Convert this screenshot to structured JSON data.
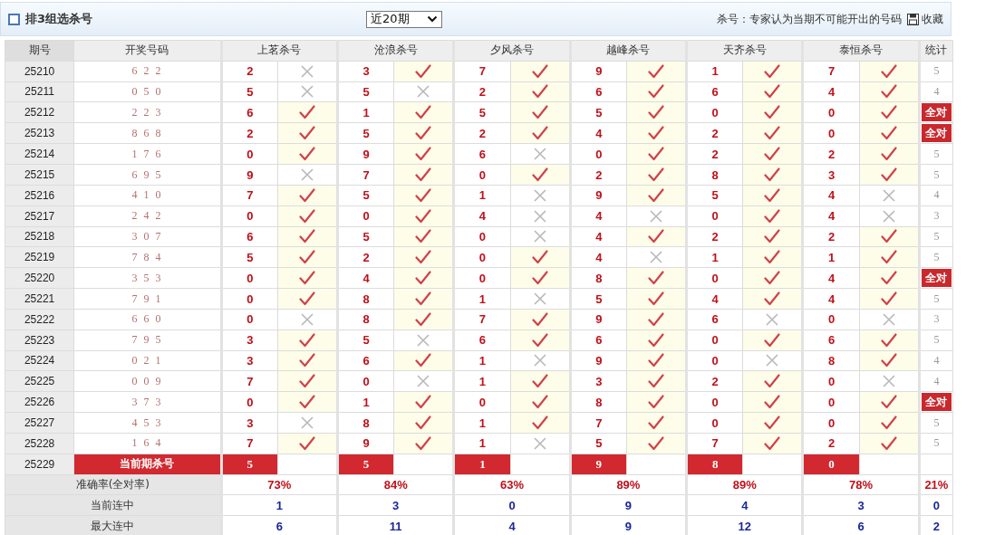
{
  "title": "排3组选杀号",
  "period_select": {
    "value": "近20期"
  },
  "note": "杀号：专家认为当期不可能开出的号码",
  "save_link": "收藏",
  "columns": {
    "period": "期号",
    "draw": "开奖号码",
    "experts": [
      "上茗杀号",
      "沧浪杀号",
      "夕风杀号",
      "越峰杀号",
      "天齐杀号",
      "泰恒杀号"
    ],
    "stat": "统计"
  },
  "rows": [
    {
      "period": "25210",
      "draw": "6 2 2",
      "picks": [
        {
          "number": "2",
          "hit": false
        },
        {
          "number": "3",
          "hit": true
        },
        {
          "number": "7",
          "hit": true
        },
        {
          "number": "9",
          "hit": true
        },
        {
          "number": "1",
          "hit": true
        },
        {
          "number": "7",
          "hit": true
        }
      ],
      "stat": "5",
      "all_correct": false
    },
    {
      "period": "25211",
      "draw": "0 5 0",
      "picks": [
        {
          "number": "5",
          "hit": false
        },
        {
          "number": "5",
          "hit": false
        },
        {
          "number": "2",
          "hit": true
        },
        {
          "number": "6",
          "hit": true
        },
        {
          "number": "6",
          "hit": true
        },
        {
          "number": "4",
          "hit": true
        }
      ],
      "stat": "4",
      "all_correct": false
    },
    {
      "period": "25212",
      "draw": "2 2 3",
      "picks": [
        {
          "number": "6",
          "hit": true
        },
        {
          "number": "1",
          "hit": true
        },
        {
          "number": "5",
          "hit": true
        },
        {
          "number": "5",
          "hit": true
        },
        {
          "number": "0",
          "hit": true
        },
        {
          "number": "0",
          "hit": true
        }
      ],
      "stat": "全对",
      "all_correct": true
    },
    {
      "period": "25213",
      "draw": "8 6 8",
      "picks": [
        {
          "number": "2",
          "hit": true
        },
        {
          "number": "5",
          "hit": true
        },
        {
          "number": "2",
          "hit": true
        },
        {
          "number": "4",
          "hit": true
        },
        {
          "number": "2",
          "hit": true
        },
        {
          "number": "0",
          "hit": true
        }
      ],
      "stat": "全对",
      "all_correct": true
    },
    {
      "period": "25214",
      "draw": "1 7 6",
      "picks": [
        {
          "number": "0",
          "hit": true
        },
        {
          "number": "9",
          "hit": true
        },
        {
          "number": "6",
          "hit": false
        },
        {
          "number": "0",
          "hit": true
        },
        {
          "number": "2",
          "hit": true
        },
        {
          "number": "2",
          "hit": true
        }
      ],
      "stat": "5",
      "all_correct": false
    },
    {
      "period": "25215",
      "draw": "6 9 5",
      "picks": [
        {
          "number": "9",
          "hit": false
        },
        {
          "number": "7",
          "hit": true
        },
        {
          "number": "0",
          "hit": true
        },
        {
          "number": "2",
          "hit": true
        },
        {
          "number": "8",
          "hit": true
        },
        {
          "number": "3",
          "hit": true
        }
      ],
      "stat": "5",
      "all_correct": false
    },
    {
      "period": "25216",
      "draw": "4 1 0",
      "picks": [
        {
          "number": "7",
          "hit": true
        },
        {
          "number": "5",
          "hit": true
        },
        {
          "number": "1",
          "hit": false
        },
        {
          "number": "9",
          "hit": true
        },
        {
          "number": "5",
          "hit": true
        },
        {
          "number": "4",
          "hit": false
        }
      ],
      "stat": "4",
      "all_correct": false
    },
    {
      "period": "25217",
      "draw": "2 4 2",
      "picks": [
        {
          "number": "0",
          "hit": true
        },
        {
          "number": "0",
          "hit": true
        },
        {
          "number": "4",
          "hit": false
        },
        {
          "number": "4",
          "hit": false
        },
        {
          "number": "0",
          "hit": true
        },
        {
          "number": "4",
          "hit": false
        }
      ],
      "stat": "3",
      "all_correct": false
    },
    {
      "period": "25218",
      "draw": "3 0 7",
      "picks": [
        {
          "number": "6",
          "hit": true
        },
        {
          "number": "5",
          "hit": true
        },
        {
          "number": "0",
          "hit": false
        },
        {
          "number": "4",
          "hit": true
        },
        {
          "number": "2",
          "hit": true
        },
        {
          "number": "2",
          "hit": true
        }
      ],
      "stat": "5",
      "all_correct": false
    },
    {
      "period": "25219",
      "draw": "7 8 4",
      "picks": [
        {
          "number": "5",
          "hit": true
        },
        {
          "number": "2",
          "hit": true
        },
        {
          "number": "0",
          "hit": true
        },
        {
          "number": "4",
          "hit": false
        },
        {
          "number": "1",
          "hit": true
        },
        {
          "number": "1",
          "hit": true
        }
      ],
      "stat": "5",
      "all_correct": false
    },
    {
      "period": "25220",
      "draw": "3 5 3",
      "picks": [
        {
          "number": "0",
          "hit": true
        },
        {
          "number": "4",
          "hit": true
        },
        {
          "number": "0",
          "hit": true
        },
        {
          "number": "8",
          "hit": true
        },
        {
          "number": "0",
          "hit": true
        },
        {
          "number": "4",
          "hit": true
        }
      ],
      "stat": "全对",
      "all_correct": true
    },
    {
      "period": "25221",
      "draw": "7 9 1",
      "picks": [
        {
          "number": "0",
          "hit": true
        },
        {
          "number": "8",
          "hit": true
        },
        {
          "number": "1",
          "hit": false
        },
        {
          "number": "5",
          "hit": true
        },
        {
          "number": "4",
          "hit": true
        },
        {
          "number": "4",
          "hit": true
        }
      ],
      "stat": "5",
      "all_correct": false
    },
    {
      "period": "25222",
      "draw": "6 6 0",
      "picks": [
        {
          "number": "0",
          "hit": false
        },
        {
          "number": "8",
          "hit": true
        },
        {
          "number": "7",
          "hit": true
        },
        {
          "number": "9",
          "hit": true
        },
        {
          "number": "6",
          "hit": false
        },
        {
          "number": "0",
          "hit": false
        }
      ],
      "stat": "3",
      "all_correct": false
    },
    {
      "period": "25223",
      "draw": "7 9 5",
      "picks": [
        {
          "number": "3",
          "hit": true
        },
        {
          "number": "5",
          "hit": false
        },
        {
          "number": "6",
          "hit": true
        },
        {
          "number": "6",
          "hit": true
        },
        {
          "number": "0",
          "hit": true
        },
        {
          "number": "6",
          "hit": true
        }
      ],
      "stat": "5",
      "all_correct": false
    },
    {
      "period": "25224",
      "draw": "0 2 1",
      "picks": [
        {
          "number": "3",
          "hit": true
        },
        {
          "number": "6",
          "hit": true
        },
        {
          "number": "1",
          "hit": false
        },
        {
          "number": "9",
          "hit": true
        },
        {
          "number": "0",
          "hit": false
        },
        {
          "number": "8",
          "hit": true
        }
      ],
      "stat": "4",
      "all_correct": false
    },
    {
      "period": "25225",
      "draw": "0 0 9",
      "picks": [
        {
          "number": "7",
          "hit": true
        },
        {
          "number": "0",
          "hit": false
        },
        {
          "number": "1",
          "hit": true
        },
        {
          "number": "3",
          "hit": true
        },
        {
          "number": "2",
          "hit": true
        },
        {
          "number": "0",
          "hit": false
        }
      ],
      "stat": "4",
      "all_correct": false
    },
    {
      "period": "25226",
      "draw": "3 7 3",
      "picks": [
        {
          "number": "0",
          "hit": true
        },
        {
          "number": "1",
          "hit": true
        },
        {
          "number": "0",
          "hit": true
        },
        {
          "number": "8",
          "hit": true
        },
        {
          "number": "0",
          "hit": true
        },
        {
          "number": "0",
          "hit": true
        }
      ],
      "stat": "全对",
      "all_correct": true
    },
    {
      "period": "25227",
      "draw": "4 5 3",
      "picks": [
        {
          "number": "3",
          "hit": false
        },
        {
          "number": "8",
          "hit": true
        },
        {
          "number": "1",
          "hit": true
        },
        {
          "number": "7",
          "hit": true
        },
        {
          "number": "0",
          "hit": true
        },
        {
          "number": "0",
          "hit": true
        }
      ],
      "stat": "5",
      "all_correct": false
    },
    {
      "period": "25228",
      "draw": "1 6 4",
      "picks": [
        {
          "number": "7",
          "hit": true
        },
        {
          "number": "9",
          "hit": true
        },
        {
          "number": "1",
          "hit": false
        },
        {
          "number": "5",
          "hit": true
        },
        {
          "number": "7",
          "hit": true
        },
        {
          "number": "2",
          "hit": true
        }
      ],
      "stat": "5",
      "all_correct": false
    }
  ],
  "current": {
    "period": "25229",
    "label": "当前期杀号",
    "picks": [
      "5",
      "5",
      "1",
      "9",
      "8",
      "0"
    ]
  },
  "summary": [
    {
      "label": "准确率(全对率)",
      "kind": "rate",
      "values": [
        "73%",
        "84%",
        "63%",
        "89%",
        "89%",
        "78%"
      ],
      "stat": "21%"
    },
    {
      "label": "当前连中",
      "kind": "count",
      "values": [
        "1",
        "3",
        "0",
        "9",
        "4",
        "3"
      ],
      "stat": "0"
    },
    {
      "label": "最大连中",
      "kind": "count",
      "values": [
        "6",
        "11",
        "4",
        "9",
        "12",
        "6"
      ],
      "stat": "2"
    }
  ]
}
